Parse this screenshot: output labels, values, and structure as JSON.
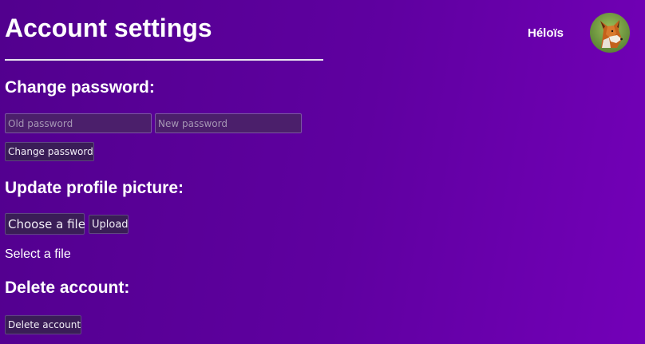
{
  "header": {
    "title": "Account settings",
    "user_name": "Héloïs",
    "avatar_icon": "fox-avatar"
  },
  "change_password": {
    "heading": "Change password:",
    "old_placeholder": "Old password",
    "old_value": "",
    "new_placeholder": "New password",
    "new_value": "",
    "button_label": "Change password"
  },
  "profile_picture": {
    "heading": "Update profile picture:",
    "choose_label": "Choose a file",
    "upload_label": "Upload",
    "file_status": "Select a file"
  },
  "delete_account": {
    "heading": "Delete account:",
    "button_label": "Delete account"
  },
  "colors": {
    "background_start": "#52008e",
    "background_end": "#7300b8",
    "text": "#ffffff"
  }
}
